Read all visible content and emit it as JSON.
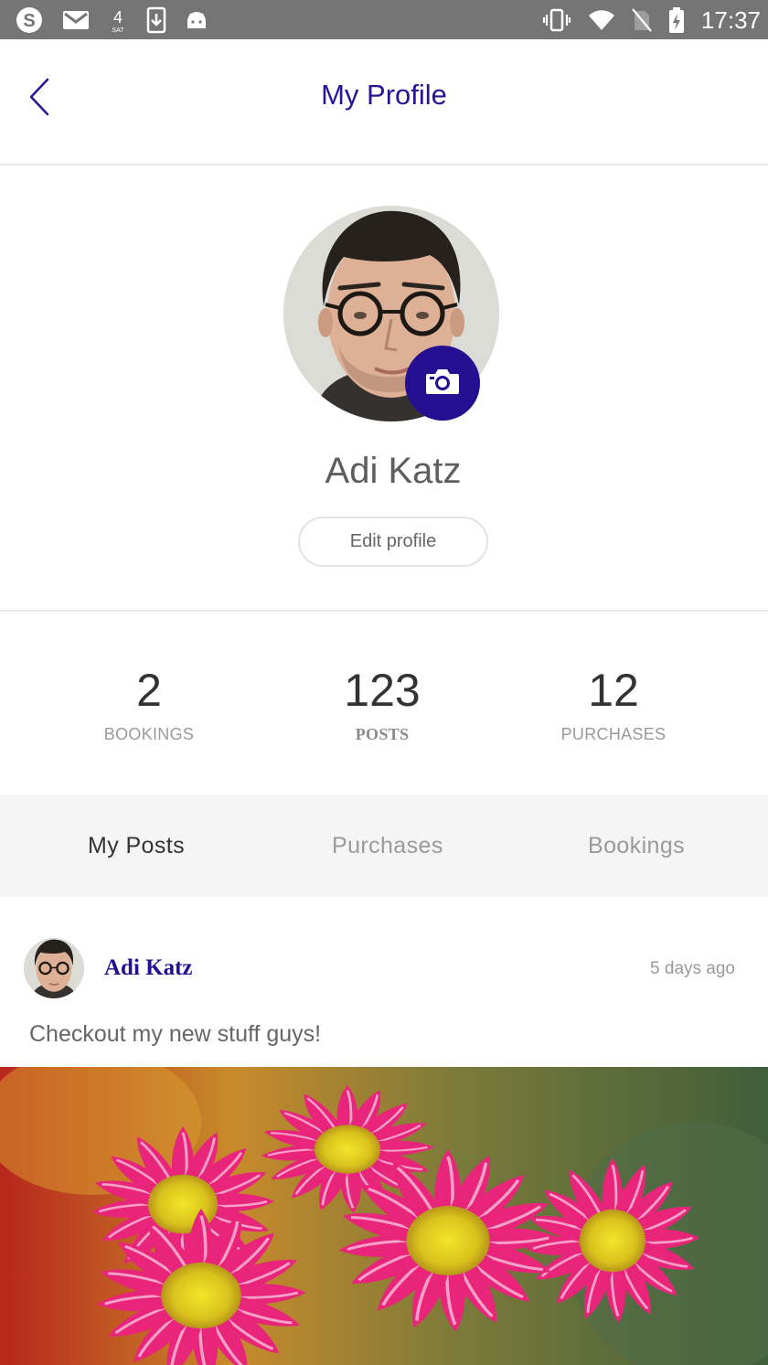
{
  "status_bar": {
    "time": "17:37",
    "left_icons": [
      "skype-icon",
      "gmail-icon",
      "network-4-icon",
      "download-icon",
      "android-icon"
    ],
    "right_icons": [
      "vibrate-icon",
      "wifi-icon",
      "no-sim-icon",
      "battery-charging-icon"
    ]
  },
  "header": {
    "title": "My Profile",
    "back_icon": "chevron-left-icon"
  },
  "profile": {
    "name": "Adi Katz",
    "edit_label": "Edit profile",
    "camera_icon": "camera-icon"
  },
  "stats": [
    {
      "value": "2",
      "label": "BOOKINGS"
    },
    {
      "value": "123",
      "label": "POSTS"
    },
    {
      "value": "12",
      "label": "PURCHASES"
    }
  ],
  "tabs": [
    {
      "label": "My Posts",
      "active": true
    },
    {
      "label": "Purchases",
      "active": false
    },
    {
      "label": "Bookings",
      "active": false
    }
  ],
  "post": {
    "author": "Adi Katz",
    "time": "5 days ago",
    "text": "Checkout my new stuff guys!"
  },
  "colors": {
    "accent": "#230f8f",
    "title": "#2a1496",
    "status_bar": "#757575",
    "tabs_bg": "#f5f5f5"
  }
}
